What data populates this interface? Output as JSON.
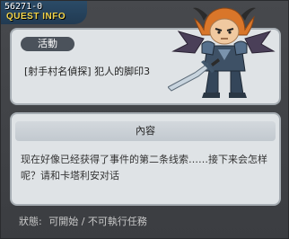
{
  "window": {
    "id": "56271-0",
    "title": "QUEST INFO"
  },
  "quest": {
    "tag": "活動",
    "name": "[射手村名偵探] 犯人的脚印3"
  },
  "info": {
    "header": "內容",
    "description": "现在好像已经获得了事件的第二条线索……接下来会怎样呢？请和卡塔利安对话"
  },
  "status": {
    "label": "狀態:",
    "value": "可開始 / 不可執行任務"
  },
  "character": {
    "icon": "warrior-character-icon"
  }
}
